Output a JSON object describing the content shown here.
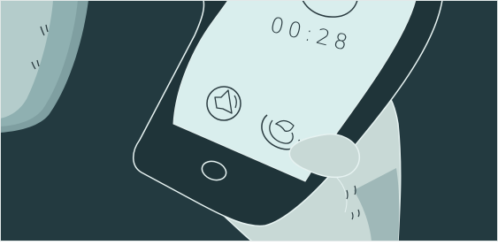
{
  "scene": {
    "description_kind": "illustration",
    "call_timer": "00:28"
  },
  "colors": {
    "background": "#233a40",
    "device_body": "#1f3439",
    "screen": "#d9eeed",
    "hand": "#c8d9d6",
    "hand_shadow": "#9fb8b8",
    "outline": "#e6f2f1",
    "ink": "#2a3b40"
  },
  "icons": {
    "speaker": "speaker-icon",
    "end_call": "phone-handset-icon",
    "home": "home-button-icon"
  }
}
